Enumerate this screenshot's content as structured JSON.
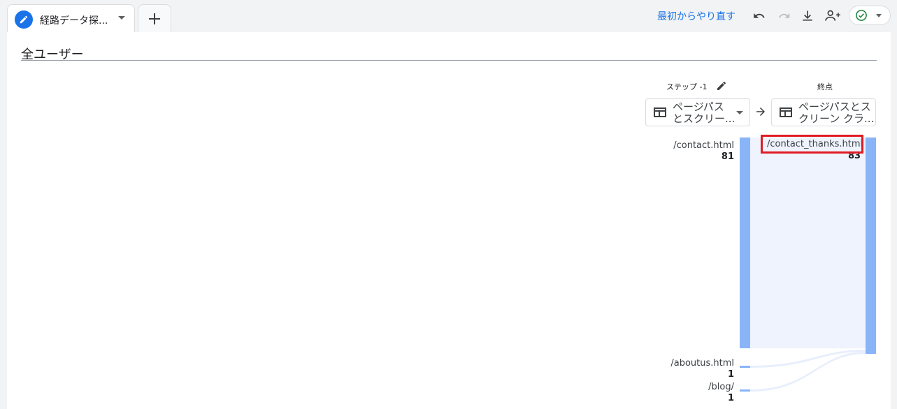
{
  "tab": {
    "label": "経路データ探...",
    "icon": "pencil-icon"
  },
  "toolbar": {
    "reset_label": "最初からやり直す",
    "icons": [
      "undo-icon",
      "redo-icon",
      "download-icon",
      "share-user-icon",
      "check-circle-icon"
    ]
  },
  "segment": {
    "title": "全ユーザー"
  },
  "columns": {
    "step_label": "ステップ -1",
    "end_label": "終点",
    "step_dimension": "ページパス\nとスクリー...",
    "end_dimension": "ページパスとス\nクリーン クラ..."
  },
  "step_nodes": [
    {
      "label": "/contact.html",
      "count": "81"
    },
    {
      "label": "/aboutus.html",
      "count": "1"
    },
    {
      "label": "/blog/",
      "count": "1"
    }
  ],
  "end_node": {
    "label": "/contact_thanks.html",
    "count": "83"
  },
  "colors": {
    "accent": "#1a73e8",
    "bar": "#8ab4f8",
    "highlight": "#e01b24"
  }
}
